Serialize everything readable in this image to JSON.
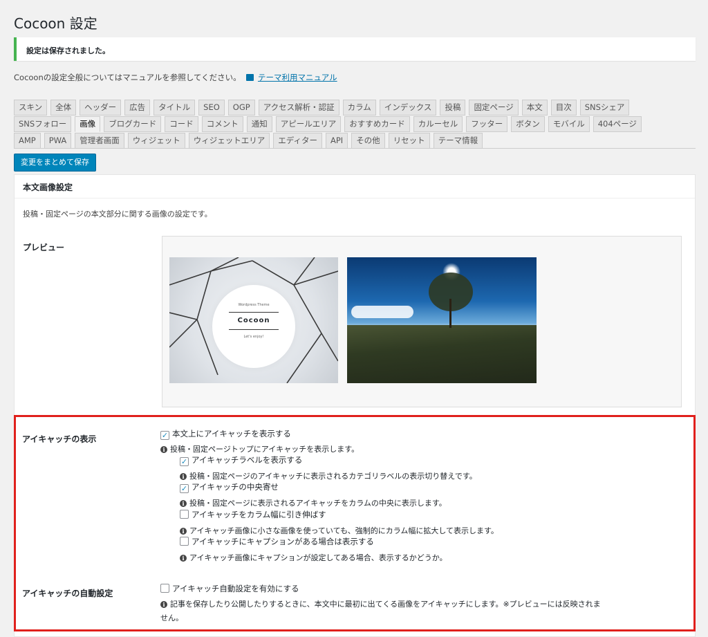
{
  "page": {
    "title": "Cocoon 設定",
    "notice": "設定は保存されました。",
    "manual_text": "Cocoonの設定全般についてはマニュアルを参照してください。",
    "manual_link": "テーマ利用マニュアル"
  },
  "tabs": {
    "row1": [
      "スキン",
      "全体",
      "ヘッダー",
      "広告",
      "タイトル",
      "SEO",
      "OGP",
      "アクセス解析・認証",
      "カラム",
      "インデックス",
      "投稿",
      "固定ページ",
      "本文",
      "目次",
      "SNSシェア"
    ],
    "row2": [
      "SNSフォロー",
      "画像",
      "ブログカード",
      "コード",
      "コメント",
      "通知",
      "アピールエリア",
      "おすすめカード",
      "カルーセル",
      "フッター",
      "ボタン",
      "モバイル",
      "404ページ"
    ],
    "row3": [
      "AMP",
      "PWA",
      "管理者画面",
      "ウィジェット",
      "ウィジェットエリア",
      "エディター",
      "API",
      "その他",
      "リセット",
      "テーマ情報"
    ],
    "active": "画像"
  },
  "save_button": "変更をまとめて保存",
  "panel": {
    "header": "本文画像設定",
    "description": "投稿・固定ページの本文部分に関する画像の設定です。",
    "preview_label": "プレビュー",
    "preview_image1": {
      "top_text": "Wordpress Theme",
      "logo_text": "Cocoon",
      "bottom_text": "Let's enjoy!"
    }
  },
  "eyecatch_display": {
    "label": "アイキャッチの表示",
    "options": [
      {
        "label": "本文上にアイキャッチを表示する",
        "checked": true,
        "note": "投稿・固定ページトップにアイキャッチを表示します。"
      },
      {
        "label": "アイキャッチラベルを表示する",
        "checked": true,
        "note": "投稿・固定ページのアイキャッチに表示されるカテゴリラベルの表示切り替えです。"
      },
      {
        "label": "アイキャッチの中央寄せ",
        "checked": true,
        "note": "投稿・固定ページに表示されるアイキャッチをカラムの中央に表示します。"
      },
      {
        "label": "アイキャッチをカラム幅に引き伸ばす",
        "checked": false,
        "note": "アイキャッチ画像に小さな画像を使っていても、強制的にカラム幅に拡大して表示します。"
      },
      {
        "label": "アイキャッチにキャプションがある場合は表示する",
        "checked": false,
        "note": "アイキャッチ画像にキャプションが設定してある場合、表示するかどうか。"
      }
    ]
  },
  "eyecatch_auto": {
    "label": "アイキャッチの自動設定",
    "option": {
      "label": "アイキャッチ自動設定を有効にする",
      "checked": false
    },
    "note_line1": "記事を保存したり公開したりするときに、本文中に最初に出てくる画像をアイキャッチにします。※プレビューには反映されま",
    "note_line2": "せん。"
  },
  "colors": {
    "primary_button": "#0085ba",
    "notice_border": "#46b450",
    "highlight_border": "#e0201c",
    "link": "#0073aa"
  }
}
